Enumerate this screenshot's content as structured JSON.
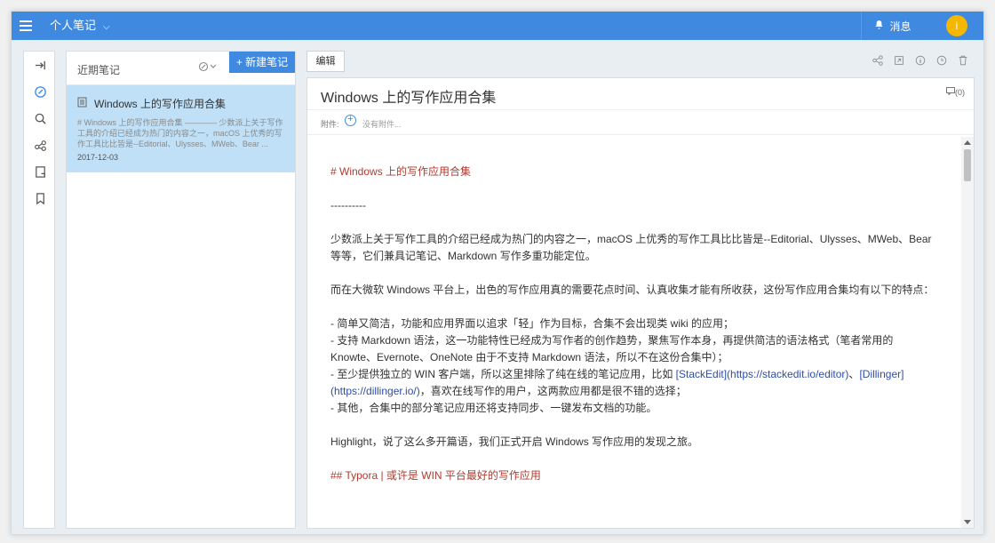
{
  "topbar": {
    "notebook_label": "个人笔记",
    "messages_label": "消息",
    "avatar_initial": "i",
    "accent": "#3f8ae0"
  },
  "rail": {
    "icons": [
      "collapse-icon",
      "edit-notes-icon",
      "search-icon",
      "share-icon",
      "notebook-icon",
      "bookmark-icon"
    ]
  },
  "notelist": {
    "title": "近期笔记",
    "new_note_label": "+ 新建笔记",
    "notes": [
      {
        "title": "Windows 上的写作应用合集",
        "excerpt": "# Windows 上的写作应用合集 ———— 少数派上关于写作工具的介绍已经成为热门的内容之一，macOS 上优秀的写作工具比比皆是--Editorial、Ulysses、MWeb、Bear ...",
        "date": "2017-12-03"
      }
    ]
  },
  "editor": {
    "edit_label": "编辑",
    "doc_title": "Windows 上的写作应用合集",
    "comment_count": "(0)",
    "attach_label": "附件:",
    "attach_empty": "没有附件...",
    "lines": {
      "h1": "# Windows 上的写作应用合集",
      "rule": "----------",
      "p1": "少数派上关于写作工具的介绍已经成为热门的内容之一，macOS 上优秀的写作工具比比皆是--Editorial、Ulysses、MWeb、Bear 等等，它们兼具记笔记、Markdown 写作多重功能定位。",
      "p2": "而在大微软 Windows 平台上，出色的写作应用真的需要花点时间、认真收集才能有所收获，这份写作应用合集均有以下的特点：",
      "li1": "- 简单又简洁，功能和应用界面以追求「轻」作为目标，合集不会出现类 wiki 的应用；",
      "li2": "- 支持 Markdown 语法，这一功能特性已经成为写作者的创作趋势，聚焦写作本身，再提供简洁的语法格式（笔者常用的 Knowte、Evernote、OneNote 由于不支持 Markdown 语法，所以不在这份合集中）；",
      "li3a": "- 至少提供独立的 WIN 客户端，所以这里排除了纯在线的笔记应用，比如 ",
      "li3link1": "[StackEdit](https://stackedit.io/editor)",
      "li3sep": "、",
      "li3link2": "[Dillinger](https://dillinger.io/)",
      "li3b": "，喜欢在线写作的用户，这两款应用都是很不错的选择；",
      "li4": "- 其他，合集中的部分笔记应用还将支持同步、一键发布文档的功能。",
      "p3": "Highlight，说了这么多开篇语，我们正式开启 Windows 写作应用的发现之旅。",
      "h2": "## Typora | 或许是 WIN 平台最好的写作应用"
    }
  }
}
